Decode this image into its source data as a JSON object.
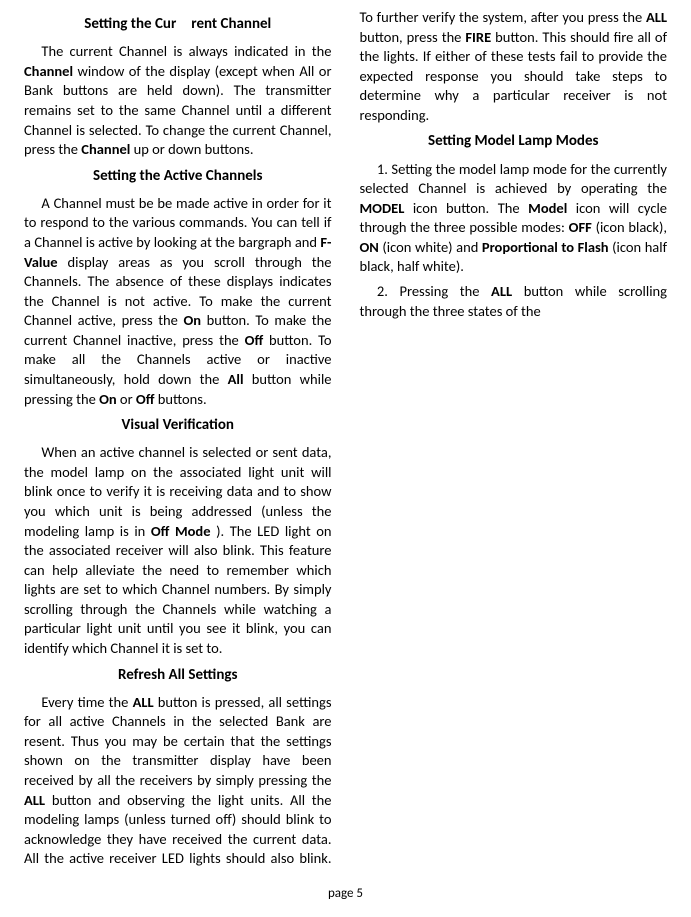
{
  "headings": {
    "h1": "Setting the Cur rent Channel",
    "h2": "Setting the Active Channels",
    "h3": "Visual  Verification",
    "h4": "Refresh All Settings",
    "h5": "Setting Model Lamp Modes"
  },
  "para": {
    "p1a": "The current Channel is always indicat­ed in the ",
    "p1b": "Channel",
    "p1c": "  window of the dis­play (except when All or Bank buttons are held down). The transmitter remains set to the same Channel until a different Channel is selected. To change the cur­rent Channel, press the ",
    "p1d": "Channel",
    "p1e": "  up or down buttons.",
    "p2a": "A Channel must be be made active in order for it to respond to the var­ious commands. You can tell if a Channel is active by looking at the bargraph and ",
    "p2b": "F-Value",
    "p2c": "  display areas as you scroll through the Channels. The absence of these displays indi­cates the Channel is not active. To make the current Channel active, press the ",
    "p2d": "On",
    "p2e": " button. To make the current Channel inactive, press the ",
    "p2f": "Off",
    "p2g": " button. To make all the Channels active or inactive simultaneously, hold down the ",
    "p2h": "All",
    "p2i": " button while pressing the ",
    "p2j": "On",
    "p2k": " or ",
    "p2l": "Off",
    "p2m": " buttons.",
    "p3a": "When an active channel is selected or sent data, the model lamp on the associated light unit will blink once to verify it is receiving data and to show you which unit is being addressed (unless the modeling lamp is in ",
    "p3b": "Off Mode",
    "p3c": " ). The LED light on the associated receiver will also blink. This feature can help alleviate the need to remember which lights are set to which Channel numbers. By simply scrolling through the Channels while watching a particular light unit until you see it blink, you can identify which Channel it is set to.",
    "p4a": "Every time the ",
    "p4b": "ALL",
    "p4c": " button is pressed, all settings for all active Channels in the selected Bank are resent. Thus you may be certain that the settings shown on the transmitter display have been received by all the receivers by simply pressing the ",
    "p4d": "ALL",
    "p4e": " button and observing the light units. All the modeling lamps (unless turned off) should blink to acknowledge they have received the current  data. All the active receiver LED lights should also blink. To further verify the system, after you press the ",
    "p4f": "ALL",
    "p4g": " button, press the ",
    "p4h": "FIRE",
    "p4i": " button. This should fire all of the lights. If either of these tests fail to pro­vide the expected response you should take steps to determine why a particular receiver is not responding.",
    "p5a": "1.  Setting the model lamp mode for the currently selected Channel is achieved by operating the ",
    "p5b": "MODEL",
    "p5c": " icon button. The ",
    "p5d": "Model",
    "p5e": " icon will cycle through the three possible modes: ",
    "p5f": "OFF",
    "p5g": " (icon black), ",
    "p5h": "ON",
    "p5i": " (icon white) and ",
    "p5j": "Proportional to Flash",
    "p5k": " (icon half black, half white).",
    "p6a": "2. Pressing the ",
    "p6b": "ALL",
    "p6c": " button while scrolling through the three states of the"
  },
  "footer": "page 5"
}
